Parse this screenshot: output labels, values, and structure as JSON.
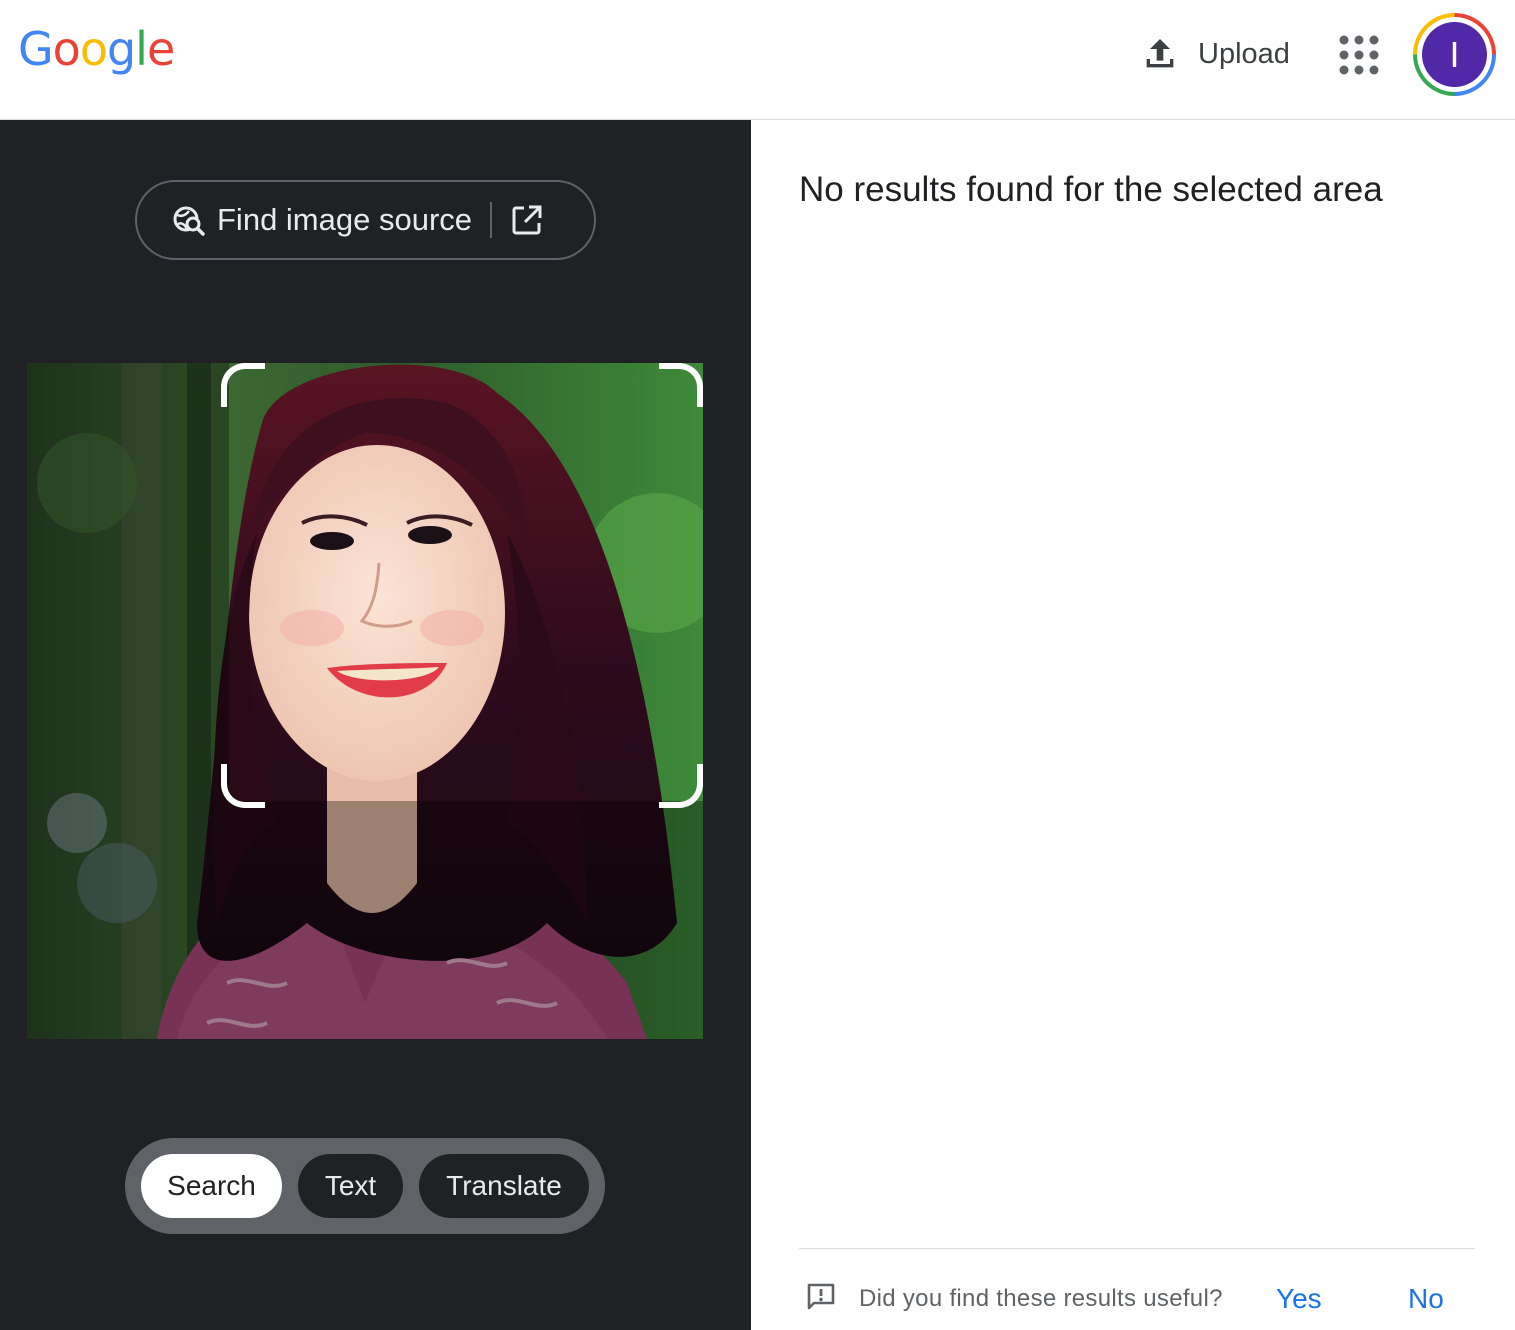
{
  "header": {
    "logo_letters": [
      {
        "ch": "G",
        "color": "#4285f4"
      },
      {
        "ch": "o",
        "color": "#ea4335"
      },
      {
        "ch": "o",
        "color": "#fbbc05"
      },
      {
        "ch": "g",
        "color": "#4285f4"
      },
      {
        "ch": "l",
        "color": "#34a853"
      },
      {
        "ch": "e",
        "color": "#ea4335"
      }
    ],
    "upload_label": "Upload",
    "upload_icon": "upload-icon",
    "apps_icon": "apps-grid-icon",
    "avatar_initial": "I",
    "avatar_color": "#5128a8"
  },
  "left_panel": {
    "find_source_label": "Find image source",
    "lens_icon": "lens-search-icon",
    "open_icon": "open-in-new-icon",
    "photo_alt": "Portrait of a smiling woman with dark red hair in front of green foliage",
    "modes": [
      {
        "label": "Search",
        "active": true
      },
      {
        "label": "Text",
        "active": false
      },
      {
        "label": "Translate",
        "active": false
      }
    ]
  },
  "right_panel": {
    "message": "No results found for the selected area",
    "feedback": {
      "question": "Did you find these results useful?",
      "yes": "Yes",
      "no": "No",
      "icon": "feedback-icon"
    }
  },
  "colors": {
    "dark_bg": "#202124",
    "link_blue": "#1a73e8"
  }
}
